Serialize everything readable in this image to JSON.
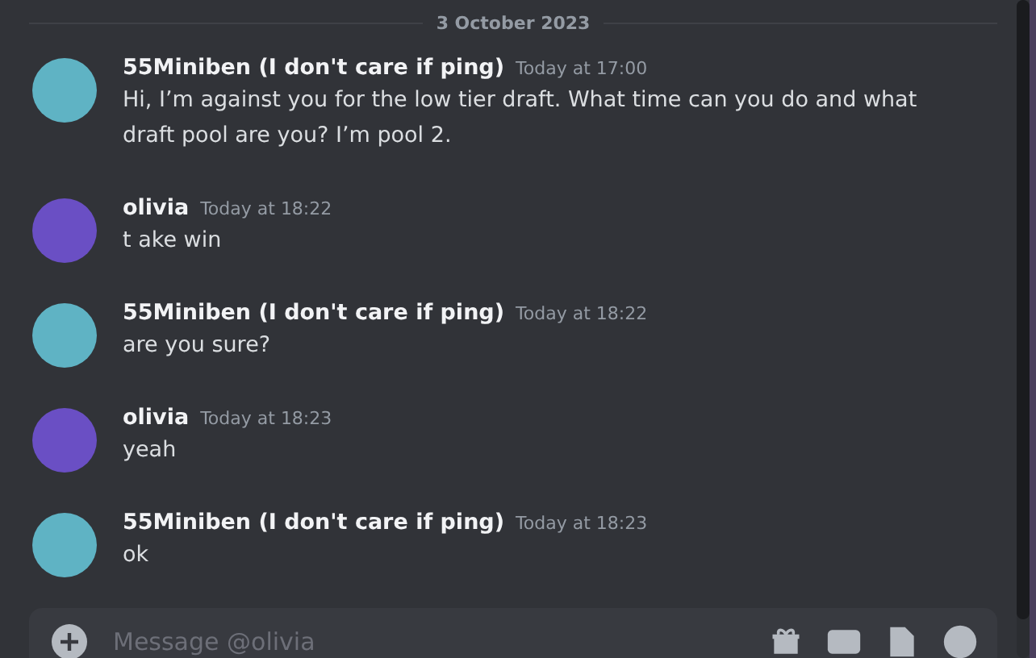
{
  "date_divider": "3 October 2023",
  "messages": [
    {
      "author": "55Miniben (I don't care if ping)",
      "time": "Today at 17:00",
      "text": "Hi, I’m against you for the low tier draft. What time can you do and what draft pool are you? I’m pool 2.",
      "color": "#5fb3c4"
    },
    {
      "author": "olivia",
      "time": "Today at 18:22",
      "text": "t ake win",
      "color": "#6a4fc4"
    },
    {
      "author": "55Miniben (I don't care if ping)",
      "time": "Today at 18:22",
      "text": "are you sure?",
      "color": "#5fb3c4"
    },
    {
      "author": "olivia",
      "time": "Today at 18:23",
      "text": "yeah",
      "color": "#6a4fc4"
    },
    {
      "author": "55Miniben (I don't care if ping)",
      "time": "Today at 18:23",
      "text": "ok",
      "color": "#5fb3c4"
    }
  ],
  "composer": {
    "placeholder": "Message @olivia"
  }
}
